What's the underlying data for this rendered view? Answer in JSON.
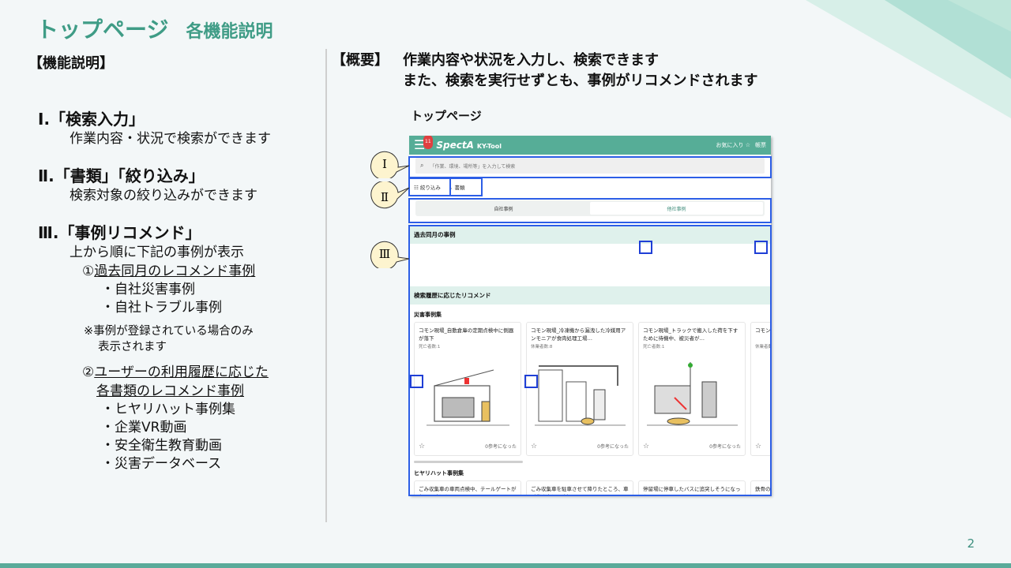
{
  "slide": {
    "title": "トップページ",
    "subtitle": "各機能説明",
    "page_number": "2"
  },
  "left": {
    "heading": "【機能説明】",
    "f1_title": "Ⅰ.「検索入力」",
    "f1_desc": "作業内容・状況で検索ができます",
    "f2_title": "Ⅱ.「書類」「絞り込み」",
    "f2_desc": "検索対象の絞り込みができます",
    "f3_title": "Ⅲ.「事例リコメンド」",
    "f3_desc": "上から順に下記の事例が表示",
    "reco1_num": "①",
    "reco1_text": "過去同月のレコメンド事例",
    "reco1_items": [
      "・自社災害事例",
      "・自社トラブル事例"
    ],
    "note_line1": "※事例が登録されている場合のみ",
    "note_line2": "表示されます",
    "reco2_num": "②",
    "reco2_text1": "ユーザーの利用履歴に応じた",
    "reco2_text2": "各書類のレコメンド事例",
    "reco2_items": [
      "・ヒヤリハット事例集",
      "・企業VR動画",
      "・安全衛生教育動画",
      "・災害データベース"
    ]
  },
  "overview": {
    "label": "【概要】",
    "line1": "作業内容や状況を入力し、検索できます",
    "line2": "また、検索を実行せずとも、事例がリコメンドされます"
  },
  "screen_caption": "トップページ",
  "callouts": [
    "Ⅰ",
    "Ⅱ",
    "Ⅲ"
  ],
  "app": {
    "notif_count": "11",
    "brand": "SpectA",
    "brand_sub": "KY-Tool",
    "favorites": "お気に入り ☆",
    "account": "帳票",
    "search_placeholder": "「作業、環境、場所等」を入力して検索",
    "filter_label": "絞り込み",
    "doc_label": "書類",
    "tab_own": "自社事例",
    "tab_other": "他社事例",
    "section_past": "過去同月の事例",
    "section_reco": "検索履歴に応じたリコメンド",
    "disaster_heading": "災害事例集",
    "disaster_cards": [
      {
        "title": "コモン現場_自動倉庫の定期点検中に側器が落下",
        "meta": "死亡者数:1",
        "ref": "0参考になった"
      },
      {
        "title": "コモン現場_冷凍機から漏洩した冷媒用アンモニアが食肉処理工場…",
        "meta": "休業者数:8",
        "ref": "0参考になった"
      },
      {
        "title": "コモン現場_トラックで搬入した荷を下すために待機中、被災者が…",
        "meta": "死亡者数:1",
        "ref": "0参考になった"
      },
      {
        "title": "コモン現場_料の…",
        "meta": "休業者数",
        "ref": ""
      }
    ],
    "hiyari_heading": "ヒヤリハット事例集",
    "hiyari_cards": [
      {
        "title": "ごみ収集車の車両点検中、テールゲートが急に下降した"
      },
      {
        "title": "ごみ収集車を駐車させて降りたところ、車が動き出して建設との"
      },
      {
        "title": "停留場に停車したバスに追突しそうになった"
      },
      {
        "title": "鉄骨の…"
      }
    ]
  },
  "colors": {
    "accent": "#3f9c86",
    "app_header": "#56ad97",
    "highlight": "#2c5ee6"
  }
}
